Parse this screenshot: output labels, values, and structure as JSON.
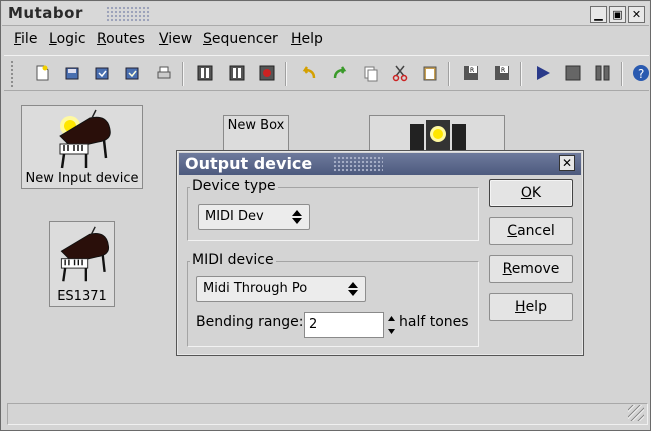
{
  "window": {
    "title": "Mutabor"
  },
  "menu": {
    "file": "File",
    "logic": "Logic",
    "routes": "Routes",
    "view": "View",
    "sequencer": "Sequencer",
    "help": "Help"
  },
  "toolbar": {
    "icons": [
      "new-file-icon",
      "open-icon",
      "save-icon",
      "save-as-icon",
      "print-icon",
      "logic-activate-icon",
      "logic-stop-icon",
      "logic-record-icon",
      "undo-icon",
      "redo-icon",
      "copy-icon",
      "cut-icon",
      "paste-icon",
      "route-load-icon",
      "route-save-icon",
      "play-icon",
      "stop-icon",
      "pause-icon",
      "help-icon"
    ]
  },
  "canvas": {
    "devices": [
      {
        "label": "New Input device",
        "icon": "grand-piano-icon"
      },
      {
        "label": "ES1371",
        "icon": "grand-piano-icon"
      },
      {
        "label": "New Box",
        "icon": "box-icon"
      },
      {
        "label": "",
        "icon": "speaker-icon"
      }
    ]
  },
  "dialog": {
    "title": "Output device",
    "device_type": {
      "label": "Device type",
      "value": "MIDI Dev"
    },
    "midi_device": {
      "label": "MIDI device",
      "value": "Midi Through Po",
      "bending_label": "Bending range:",
      "bending_value": "2",
      "bending_unit": "half tones"
    },
    "buttons": {
      "ok": "OK",
      "cancel": "Cancel",
      "remove": "Remove",
      "help": "Help"
    }
  },
  "colors": {
    "dialog_title_bg": "#5a6688",
    "accent_play": "#2a3a8a"
  }
}
